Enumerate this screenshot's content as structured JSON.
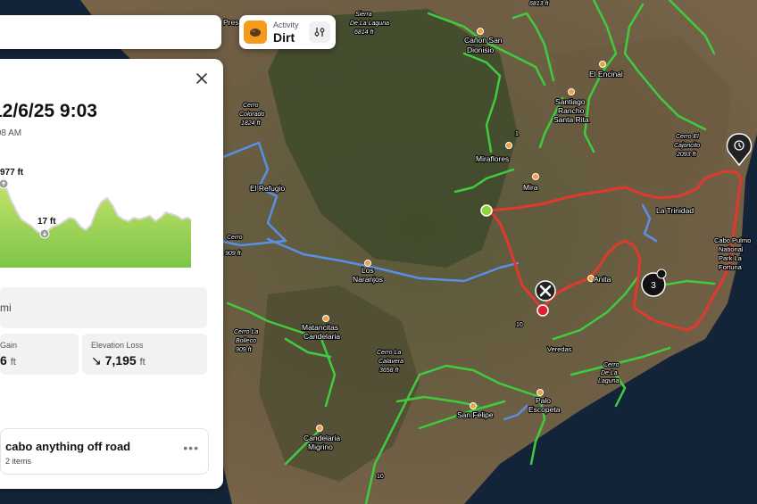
{
  "activity": {
    "label": "Activity",
    "value": "Dirt"
  },
  "details": {
    "date_title": "12/6/25 9:03",
    "date_subtitle": ":08 AM",
    "elevation": {
      "max_label": "977 ft",
      "min_label": "17 ft"
    },
    "distance_value": "mi",
    "gain": {
      "label": "Gain",
      "value": "6",
      "unit": "ft"
    },
    "loss": {
      "label": "Elevation Loss",
      "value": "7,195",
      "unit": "ft"
    }
  },
  "collection": {
    "title": "cabo anything off road",
    "subtitle": "2 items",
    "more": "•••"
  },
  "markers": {
    "waypoint_number": "3"
  },
  "map_labels": {
    "sierra": "Sierra",
    "sierra2": "De La Laguna",
    "sierra3": "6814 ft",
    "canon1": "Cañon San",
    "canon2": "Dionisio",
    "el_encinal": "El Encinal",
    "santiago1": "Santiago",
    "santiago2": "Rancho",
    "santa_rita": "Santa Rita",
    "cerro_col1": "Cerro",
    "cerro_col2": "Colorado",
    "cerro_col3": "1824 ft",
    "cerro_caj1": "Cerro El",
    "cerro_caj2": "Cajoncito",
    "cerro_caj3": "2093 ft",
    "el_refugio": "El Refugio",
    "miraflores": "Miraflores",
    "mira": "Mira",
    "la_trinidad": "La Trinidad",
    "cabo_pulmo1": "Cabo Pulmo",
    "cabo_pulmo2": "National",
    "cabo_pulmo3": "Park La",
    "cabo_pulmo4": "Fortuna",
    "los": "Los",
    "naranjos": "Naranjos",
    "anita": "Anita",
    "matancitas1": "Matancitas",
    "matancitas2": "Candelaria",
    "cerro_lab1": "Cerro La",
    "cerro_lab2": "Bolleco",
    "cerro_lab3": "909 ft",
    "cerro_calav1": "Cerro La",
    "cerro_calav2": "Calavera",
    "cerro_calav3": "3658 ft",
    "veredas": "Veredas",
    "cerro_lag1": "Cerro",
    "cerro_lag2": "De La",
    "cerro_lag3": "Laguna",
    "palo1": "Palo",
    "palo2": "Escopeta",
    "san_felipe": "San Felipe",
    "candelaria": "Candelaria",
    "migrino": "Migrino",
    "road_1": "1",
    "road_10": "10",
    "road_10b": "10",
    "peak_top": "6813 ft",
    "cerro_left": "Cerro",
    "cerro_left2": "909 ft",
    "presa": "Presa"
  },
  "colors": {
    "route": "#e0392e",
    "trail": "#3fcc3f",
    "paved": "#5a8fe6",
    "accent": "#f59a1b"
  }
}
